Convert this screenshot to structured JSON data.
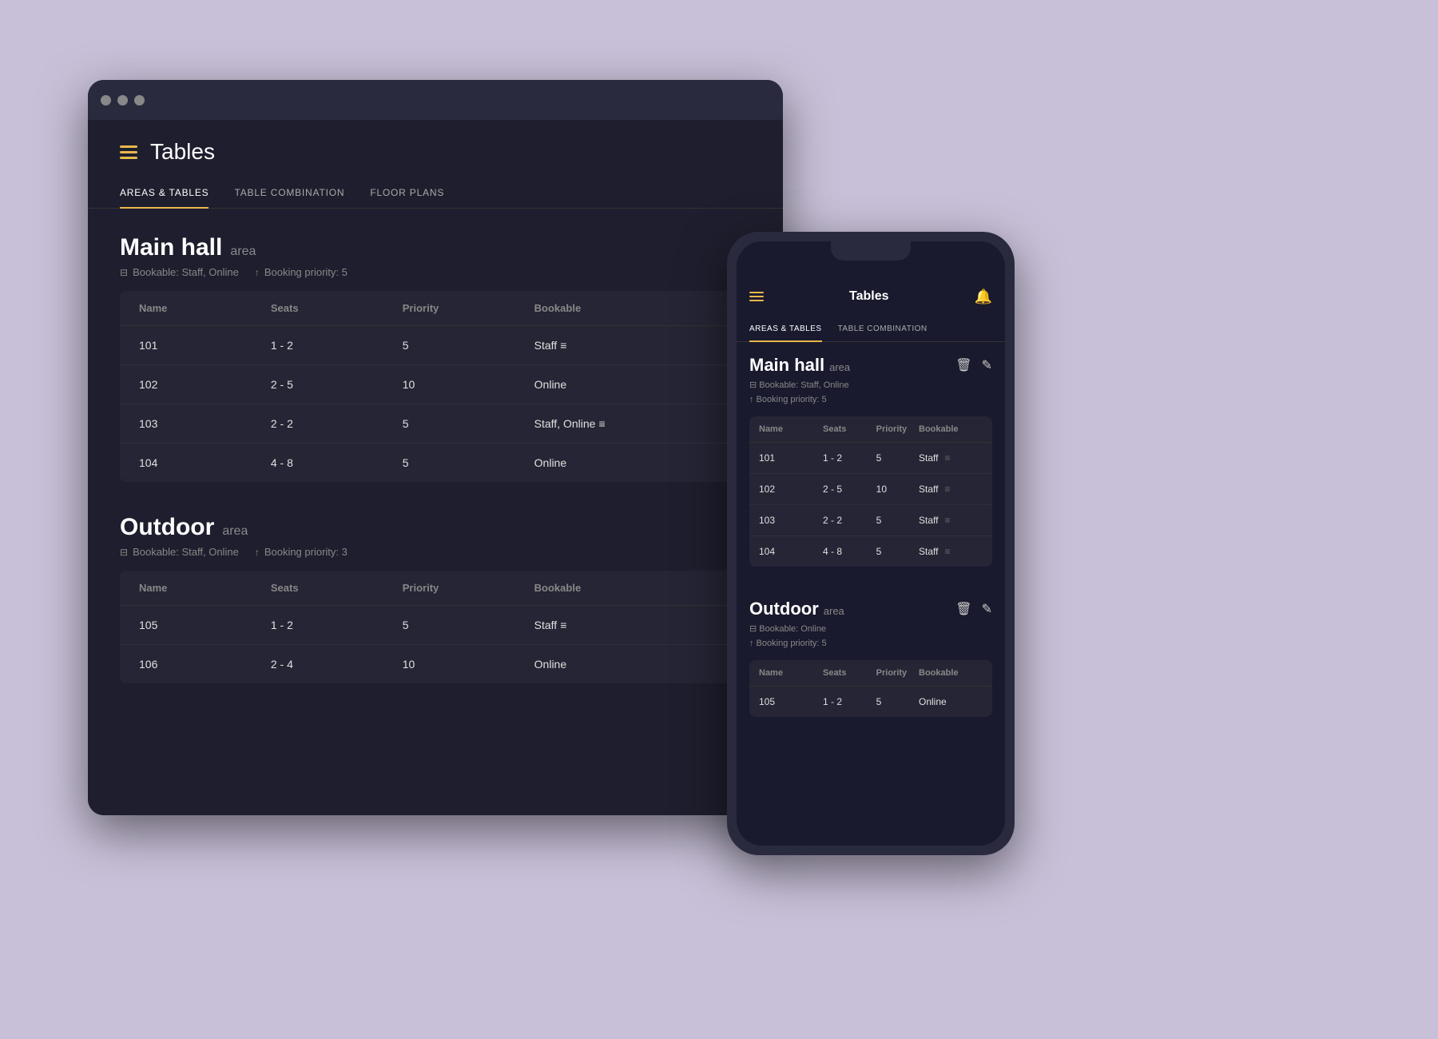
{
  "app": {
    "title": "Tables"
  },
  "desktop": {
    "tabs": [
      {
        "label": "AREAS & TABLES",
        "active": true
      },
      {
        "label": "TABLE COMBINATION",
        "active": false
      },
      {
        "label": "FLOOR PLANS",
        "active": false
      }
    ],
    "areas": [
      {
        "name": "Main hall",
        "badge": "area",
        "bookable": "Bookable: Staff, Online",
        "priority": "Booking priority: 5",
        "tables": [
          {
            "name": "101",
            "seats": "1 - 2",
            "priority": "5",
            "bookable": "Staff"
          },
          {
            "name": "102",
            "seats": "2 - 5",
            "priority": "10",
            "bookable": "Online"
          },
          {
            "name": "103",
            "seats": "2 - 2",
            "priority": "5",
            "bookable": "Staff, Online"
          },
          {
            "name": "104",
            "seats": "4 - 8",
            "priority": "5",
            "bookable": "Online"
          }
        ]
      },
      {
        "name": "Outdoor",
        "badge": "area",
        "bookable": "Bookable: Staff, Online",
        "priority": "Booking priority: 3",
        "tables": [
          {
            "name": "105",
            "seats": "1 - 2",
            "priority": "5",
            "bookable": "Staff"
          },
          {
            "name": "106",
            "seats": "2 - 4",
            "priority": "10",
            "bookable": "Online"
          }
        ]
      }
    ],
    "table_headers": [
      "Name",
      "Seats",
      "Priority",
      "Bookable",
      ""
    ]
  },
  "mobile": {
    "title": "Tables",
    "tabs": [
      {
        "label": "AREAS & TABLES",
        "active": true
      },
      {
        "label": "TABLE COMBINATION",
        "active": false
      }
    ],
    "areas": [
      {
        "name": "Main hall",
        "badge": "area",
        "bookable_line1": "⊟ Bookable: Staff, Online",
        "bookable_line2": "↑ Booking priority: 5",
        "tables": [
          {
            "name": "101",
            "seats": "1 - 2",
            "priority": "5",
            "bookable": "Staff"
          },
          {
            "name": "102",
            "seats": "2 - 5",
            "priority": "10",
            "bookable": "Staff"
          },
          {
            "name": "103",
            "seats": "2 - 2",
            "priority": "5",
            "bookable": "Staff"
          },
          {
            "name": "104",
            "seats": "4 - 8",
            "priority": "5",
            "bookable": "Staff"
          }
        ]
      },
      {
        "name": "Outdoor",
        "badge": "area",
        "bookable_line1": "⊟ Bookable: Online",
        "bookable_line2": "↑ Booking priority: 5",
        "tables": [
          {
            "name": "105",
            "seats": "1 - 2",
            "priority": "5",
            "bookable": "Online"
          }
        ]
      }
    ],
    "table_headers": [
      "Name",
      "Seats",
      "Priority",
      "Bookable"
    ]
  }
}
